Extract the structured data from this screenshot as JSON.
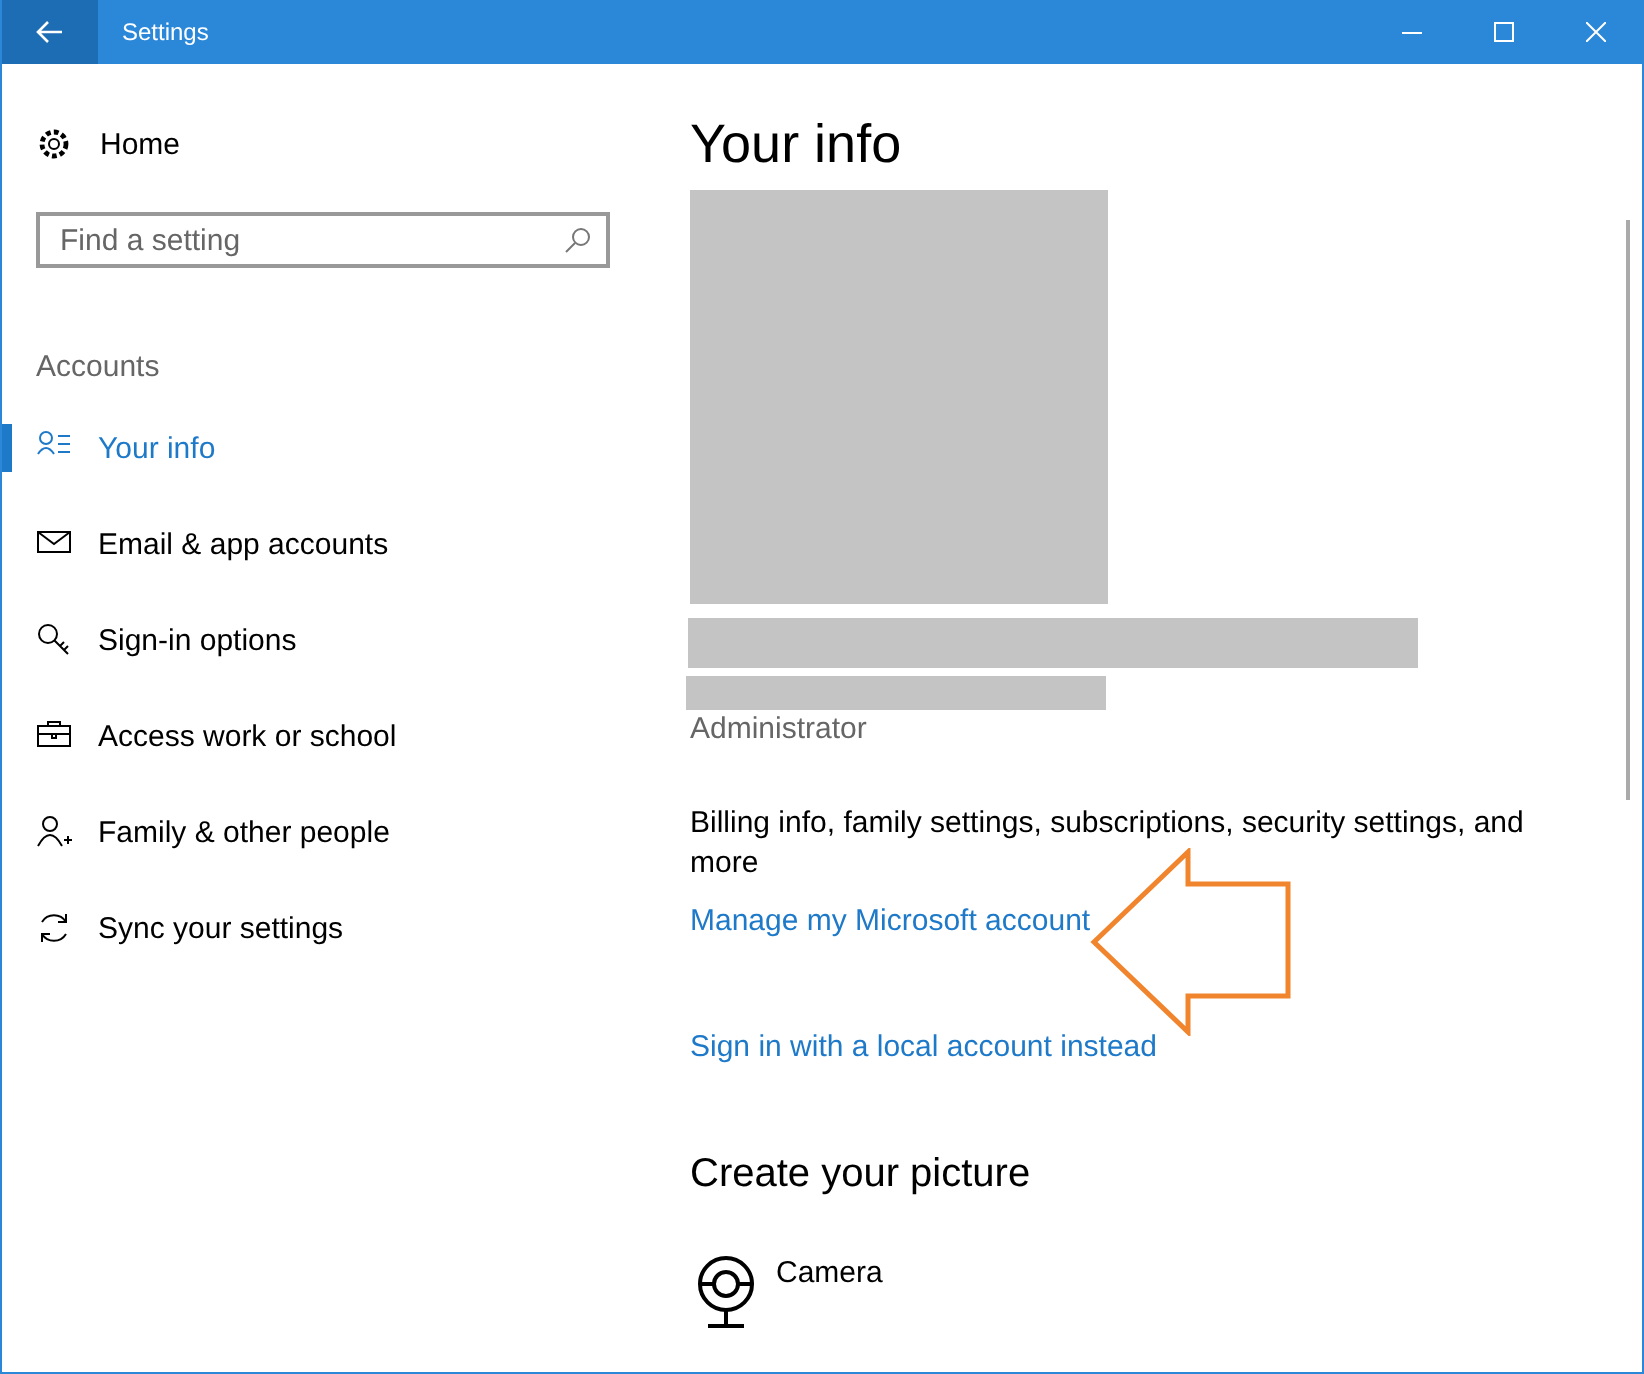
{
  "window": {
    "title": "Settings"
  },
  "sidebar": {
    "home": "Home",
    "search": {
      "placeholder": "Find a setting"
    },
    "section": "Accounts",
    "items": [
      {
        "label": "Your info",
        "selected": true
      },
      {
        "label": "Email & app accounts",
        "selected": false
      },
      {
        "label": "Sign-in options",
        "selected": false
      },
      {
        "label": "Access work or school",
        "selected": false
      },
      {
        "label": "Family & other people",
        "selected": false
      },
      {
        "label": "Sync your settings",
        "selected": false
      }
    ]
  },
  "content": {
    "title": "Your info",
    "role": "Administrator",
    "description": "Billing info, family settings, subscriptions, security settings, and more",
    "links": [
      "Manage my Microsoft account",
      "Sign in with a local account instead"
    ],
    "picture_section": {
      "title": "Create your picture",
      "options": [
        "Camera"
      ]
    }
  }
}
